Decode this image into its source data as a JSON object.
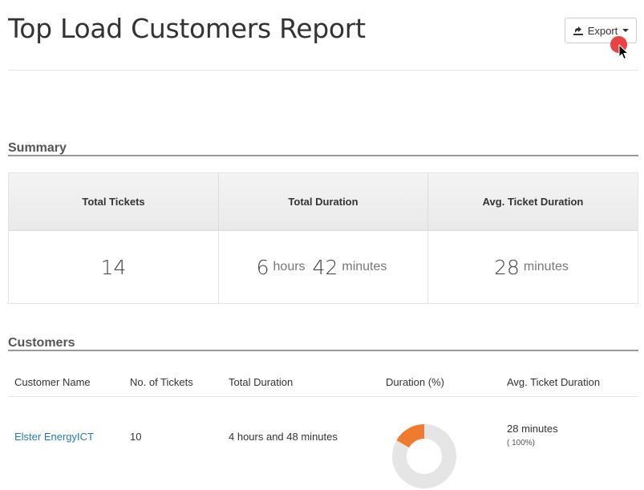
{
  "header": {
    "title": "Top Load Customers Report",
    "export_label": "Export"
  },
  "summary": {
    "title": "Summary",
    "headers": [
      "Total Tickets",
      "Total Duration",
      "Avg. Ticket Duration"
    ],
    "total_tickets": "14",
    "total_duration": {
      "hours": "6",
      "hours_unit": "hours",
      "minutes": "42",
      "minutes_unit": "minutes"
    },
    "avg_duration": {
      "minutes": "28",
      "minutes_unit": "minutes"
    }
  },
  "customers": {
    "title": "Customers",
    "columns": [
      "Customer Name",
      "No. of Tickets",
      "Total Duration",
      "Duration (%)",
      "Avg. Ticket Duration"
    ],
    "rows": [
      {
        "name": "Elster EnergyICT",
        "tickets": "10",
        "total_duration": "4 hours and 48 minutes",
        "avg_duration": "28 minutes",
        "avg_pct": "( 100%)",
        "donut_color": "#f07a2e",
        "donut_rest": "#e5e5e5"
      }
    ]
  },
  "colors": {
    "link": "#2a7ab0",
    "click_indicator": "#e8393a"
  }
}
